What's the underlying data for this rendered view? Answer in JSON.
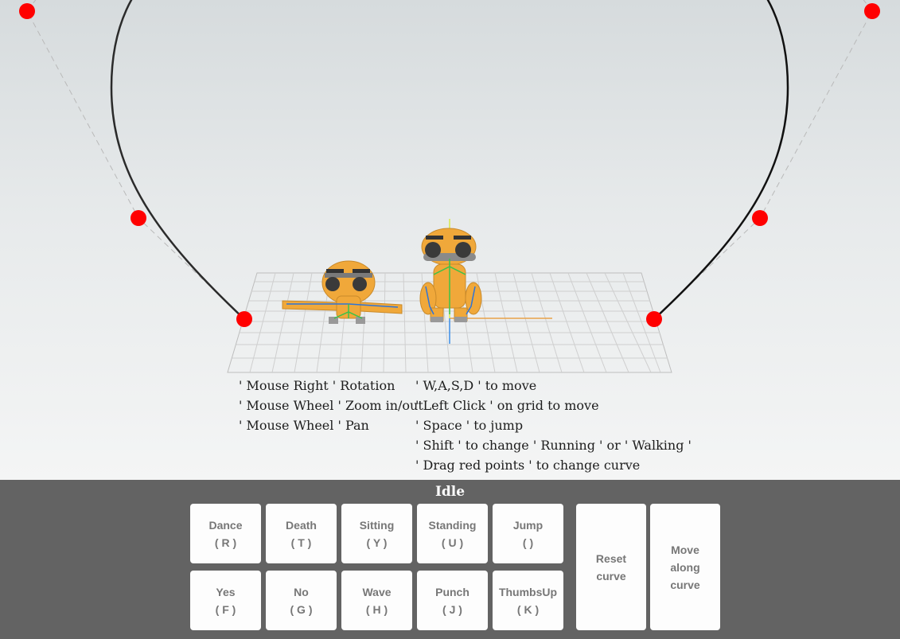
{
  "scene": {
    "curve_color": "#000000",
    "control_point_color": "#ff0000",
    "character_color": "#f0a83a",
    "grid_color": "#c8c8c8"
  },
  "help": {
    "left": [
      "' Mouse Right ' Rotation",
      "' Mouse Wheel ' Zoom in/out",
      "' Mouse Wheel ' Pan"
    ],
    "right": [
      "' W,A,S,D ' to move",
      "' Left Click ' on grid to move",
      "' Space ' to jump",
      "' Shift ' to change ' Running ' or ' Walking '",
      "' Drag red points ' to change curve"
    ]
  },
  "panel": {
    "state": "Idle",
    "buttons_row1": [
      {
        "label": "Dance",
        "key": "( R )"
      },
      {
        "label": "Death",
        "key": "( T )"
      },
      {
        "label": "Sitting",
        "key": "( Y )"
      },
      {
        "label": "Standing",
        "key": "( U )"
      },
      {
        "label": "Jump",
        "key": "(   )"
      }
    ],
    "buttons_row2": [
      {
        "label": "Yes",
        "key": "( F )"
      },
      {
        "label": "No",
        "key": "( G )"
      },
      {
        "label": "Wave",
        "key": "( H )"
      },
      {
        "label": "Punch",
        "key": "( J )"
      },
      {
        "label": "ThumbsUp",
        "key": "( K )"
      }
    ],
    "reset_curve": [
      "Reset",
      "curve"
    ],
    "move_along_curve": [
      "Move",
      "along",
      "curve"
    ]
  }
}
